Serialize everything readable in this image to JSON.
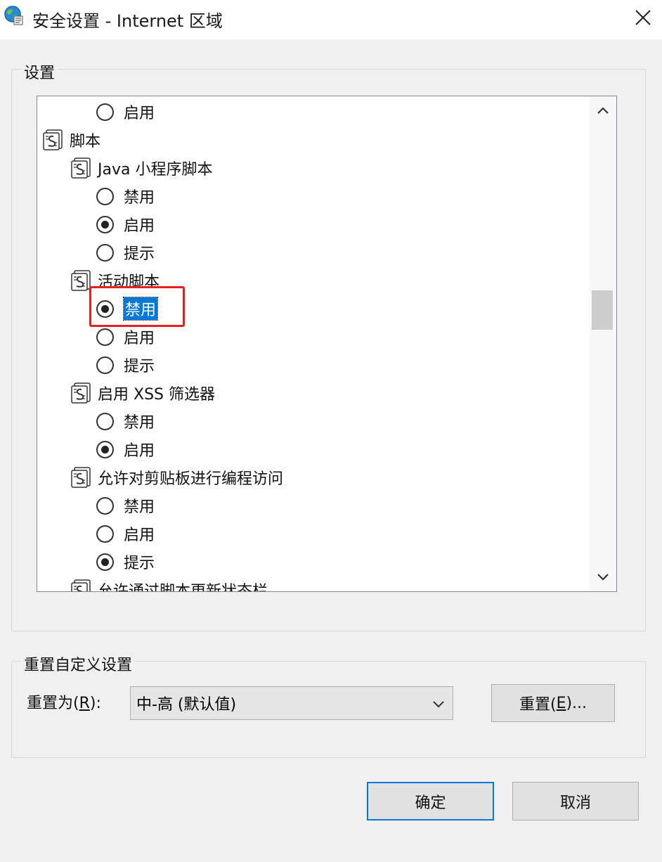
{
  "window": {
    "title": "安全设置 - Internet 区域",
    "close_glyph": "✕"
  },
  "settings_group": {
    "label": "设置",
    "rows": [
      {
        "kind": "radio",
        "indent": 2,
        "label": "启用",
        "checked": false
      },
      {
        "kind": "category",
        "indent": 0,
        "label": "脚本"
      },
      {
        "kind": "category",
        "indent": 1,
        "label": "Java 小程序脚本"
      },
      {
        "kind": "radio",
        "indent": 2,
        "label": "禁用",
        "checked": false
      },
      {
        "kind": "radio",
        "indent": 2,
        "label": "启用",
        "checked": true
      },
      {
        "kind": "radio",
        "indent": 2,
        "label": "提示",
        "checked": false
      },
      {
        "kind": "category",
        "indent": 1,
        "label": "活动脚本"
      },
      {
        "kind": "radio",
        "indent": 2,
        "label": "禁用",
        "checked": true,
        "selected": true
      },
      {
        "kind": "radio",
        "indent": 2,
        "label": "启用",
        "checked": false
      },
      {
        "kind": "radio",
        "indent": 2,
        "label": "提示",
        "checked": false
      },
      {
        "kind": "category",
        "indent": 1,
        "label": "启用 XSS 筛选器"
      },
      {
        "kind": "radio",
        "indent": 2,
        "label": "禁用",
        "checked": false
      },
      {
        "kind": "radio",
        "indent": 2,
        "label": "启用",
        "checked": true
      },
      {
        "kind": "category",
        "indent": 1,
        "label": "允许对剪贴板进行编程访问"
      },
      {
        "kind": "radio",
        "indent": 2,
        "label": "禁用",
        "checked": false
      },
      {
        "kind": "radio",
        "indent": 2,
        "label": "启用",
        "checked": false
      },
      {
        "kind": "radio",
        "indent": 2,
        "label": "提示",
        "checked": true
      },
      {
        "kind": "category",
        "indent": 1,
        "label": "允许通过脚本更新状态栏"
      }
    ]
  },
  "reset_group": {
    "label": "重置自定义设置",
    "reset_to_prefix": "重置为(",
    "reset_to_key": "R",
    "reset_to_suffix": "):",
    "combo_value": "中-高 (默认值)",
    "reset_button_prefix": "重置(",
    "reset_button_key": "E",
    "reset_button_suffix": ")..."
  },
  "footer": {
    "ok_label": "确定",
    "cancel_label": "取消"
  },
  "colors": {
    "selection": "#0078d7",
    "highlight_box": "#e0201e"
  }
}
